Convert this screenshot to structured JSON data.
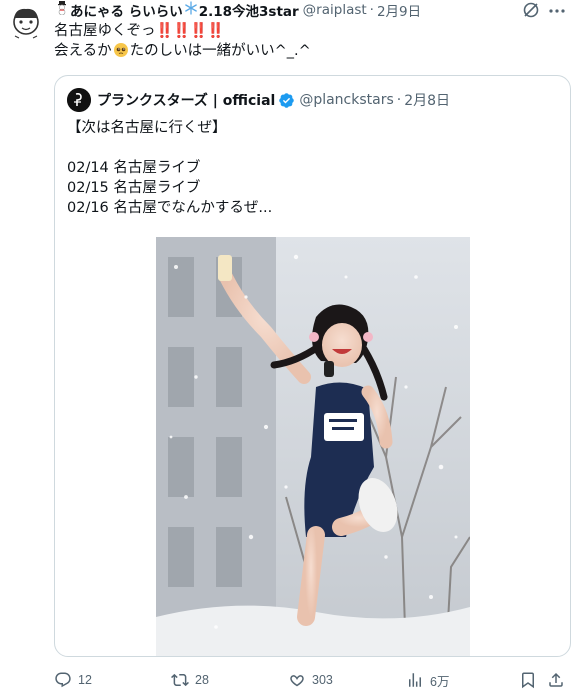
{
  "author": {
    "name_prefix": "あにゃる らいらい",
    "name_suffix": "2.18今池3star",
    "handle": "@raiplast",
    "separator": "·",
    "date": "2月9日"
  },
  "tweet": {
    "line1": "名古屋ゆくぞっ",
    "line1_marks": "‼️‼️‼️‼️",
    "line2_a": "会えるか",
    "line2_b": "たのしいは一緒がいい^_.^"
  },
  "quote": {
    "name": "プランクスターズ | official",
    "handle": "@planckstars",
    "separator": "·",
    "date": "2月8日",
    "lines": [
      "【次は名古屋に行くぜ】",
      "",
      "02/14 名古屋ライブ",
      "02/15 名古屋ライブ",
      "02/16 名古屋でなんかするぜ..."
    ]
  },
  "actions": {
    "reply_count": "12",
    "retweet_count": "28",
    "like_count": "303",
    "view_count": "6万"
  },
  "icons": {
    "reply": "reply-icon",
    "retweet": "retweet-icon",
    "like": "heart-icon",
    "views": "views-icon",
    "bookmark": "bookmark-icon",
    "share": "share-icon",
    "grok": "grok-icon",
    "more": "more-icon",
    "verified": "verified-badge-icon"
  },
  "colors": {
    "text": "#0f1419",
    "secondary": "#536471",
    "border": "#cfd9de",
    "verified": "#1d9bf0",
    "bang": "#e0245e"
  }
}
